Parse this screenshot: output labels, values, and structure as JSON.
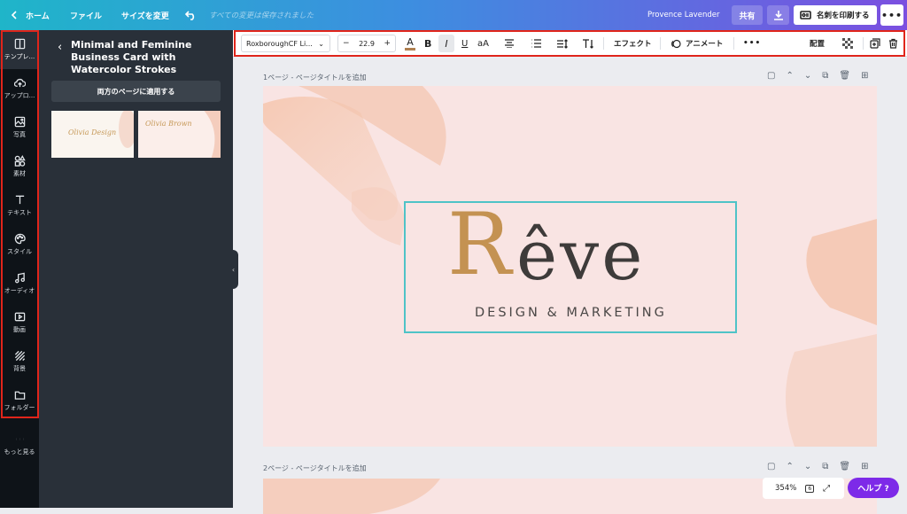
{
  "topbar": {
    "home": "ホーム",
    "file": "ファイル",
    "resize": "サイズを変更",
    "saved": "すべての変更は保存されました",
    "user": "Provence Lavender",
    "share": "共有",
    "print": "名刺を印刷する",
    "more": "•••"
  },
  "rail": [
    {
      "label": "テンプレ...",
      "icon": "template-icon"
    },
    {
      "label": "アップロ...",
      "icon": "upload-icon"
    },
    {
      "label": "写真",
      "icon": "photo-icon"
    },
    {
      "label": "素材",
      "icon": "elements-icon"
    },
    {
      "label": "テキスト",
      "icon": "text-icon"
    },
    {
      "label": "スタイル",
      "icon": "style-icon"
    },
    {
      "label": "オーディオ",
      "icon": "audio-icon"
    },
    {
      "label": "動画",
      "icon": "video-icon"
    },
    {
      "label": "背景",
      "icon": "background-icon"
    },
    {
      "label": "フォルダー",
      "icon": "folder-icon"
    },
    {
      "label": "もっと見る",
      "icon": "more-icon"
    }
  ],
  "panel": {
    "title": "Minimal and Feminine Business Card with Watercolor Strokes",
    "apply": "両方のページに適用する",
    "thumb1": "Olivia Design",
    "thumb2": "Olivia Brown"
  },
  "toolbar": {
    "font": "RoxboroughCF Li...",
    "size": "22.9",
    "minus": "−",
    "plus": "+",
    "bold": "B",
    "italic": "I",
    "underline": "U",
    "case": "aA",
    "effects": "エフェクト",
    "animate": "アニメート",
    "more": "•••",
    "position": "配置"
  },
  "pages": {
    "page1": "1ページ - ページタイトルを追加",
    "page2": "2ページ - ページタイトルを追加"
  },
  "design": {
    "logo_first": "R",
    "logo_rest": "êve",
    "tagline": "DESIGN & MARKETING"
  },
  "zoom": {
    "value": "354%"
  },
  "help": "ヘルプ ?",
  "colors": {
    "accent": "#7d2ae8",
    "selection": "#4fc3c7",
    "logo_gold": "#c49252",
    "page_bg": "#f9e4e3",
    "highlight": "#e0251b"
  }
}
